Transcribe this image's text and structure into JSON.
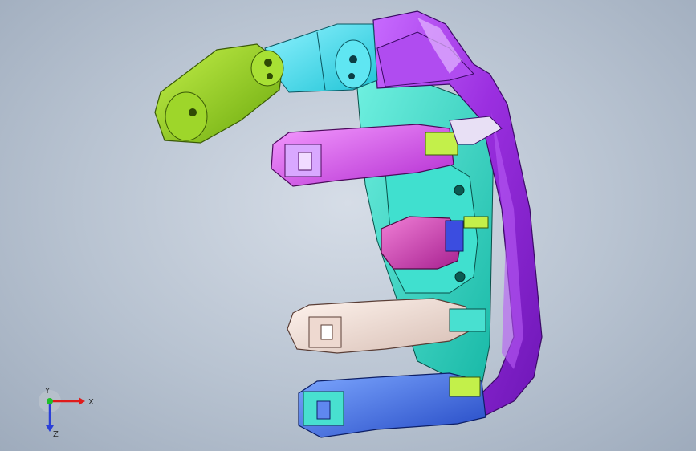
{
  "viewport": {
    "background_top": "#d6dde7",
    "background_bottom": "#9eabbc"
  },
  "model": {
    "parts": [
      {
        "name": "palm-shell",
        "color": "#9b2fe0"
      },
      {
        "name": "thumb-distal",
        "color": "#8fd21e"
      },
      {
        "name": "thumb-proximal",
        "color": "#35d8e6"
      },
      {
        "name": "finger-index",
        "color": "#d94fe8"
      },
      {
        "name": "finger-middle",
        "color": "#c93bb5"
      },
      {
        "name": "finger-ring",
        "color": "#e8d6d0"
      },
      {
        "name": "finger-little",
        "color": "#3b6ee0"
      },
      {
        "name": "palm-frame",
        "color": "#2fd9c2"
      }
    ]
  },
  "triad": {
    "x_label": "X",
    "y_label": "Y",
    "z_label": "Z",
    "x_color": "#e01b1b",
    "y_color": "#1fbf2a",
    "z_color": "#2a3fd8"
  }
}
